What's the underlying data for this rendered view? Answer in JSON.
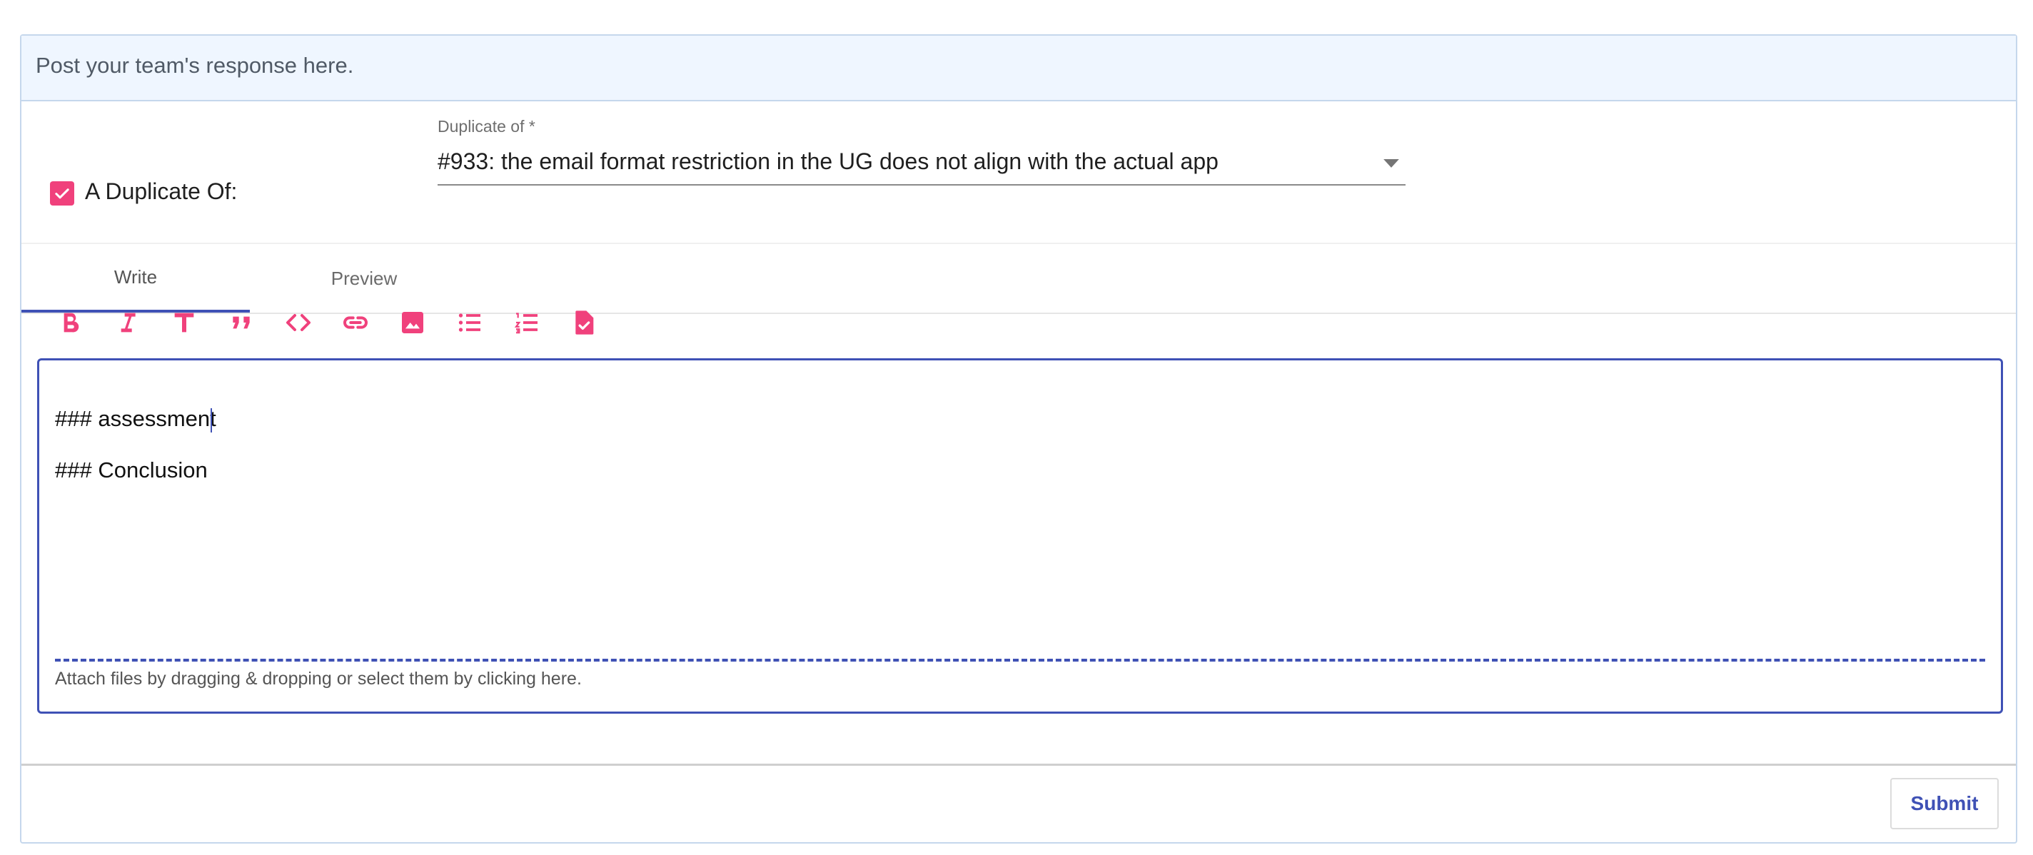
{
  "header": {
    "text": "Post your team's response here."
  },
  "duplicate": {
    "checkbox_checked": true,
    "label": "A Duplicate Of:",
    "select_label": "Duplicate of *",
    "select_value": "#933: the email format restriction in the UG does not align with the actual app"
  },
  "tabs": [
    {
      "label": "Write",
      "active": true
    },
    {
      "label": "Preview",
      "active": false
    }
  ],
  "toolbar": {
    "icons": [
      "bold-icon",
      "italic-icon",
      "heading-icon",
      "quote-icon",
      "code-icon",
      "link-icon",
      "image-icon",
      "bulleted-list-icon",
      "numbered-list-icon",
      "task-list-icon"
    ]
  },
  "editor": {
    "line1": "### assessment",
    "line2": "### Conclusion",
    "attach_hint": "Attach files by dragging & dropping or select them by clicking here."
  },
  "footer": {
    "submit_label": "Submit"
  },
  "colors": {
    "accent": "#f0417c",
    "primary": "#3f51b5",
    "header_bg": "#eff6ff"
  }
}
